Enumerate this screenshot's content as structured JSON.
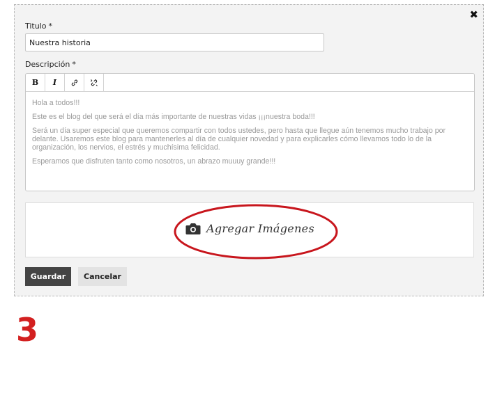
{
  "dialog": {
    "close_icon": "close-icon",
    "title_label": "Titulo",
    "title_value": "Nuestra historia",
    "description_label": "Descripción",
    "required_marker": "*",
    "toolbar": {
      "bold": "B",
      "italic": "I",
      "link_icon": "link-icon",
      "unlink_icon": "unlink-icon"
    },
    "description_paragraphs": [
      "Hola a todos!!!",
      "Este es el blog del que será el día más importante de nuestras vidas ¡¡¡nuestra boda!!!",
      "Será un día super especial que queremos compartir con todos ustedes, pero hasta que llegue aún tenemos mucho trabajo por delante. Usaremos este blog para mantenerles al día de cualquier novedad y para explicarles cómo llevamos todo lo de la organización, los nervios, el estrés y muchísima felicidad.",
      "Esperamos que disfruten tanto como nosotros, un abrazo muuuy grande!!!"
    ],
    "upload": {
      "icon": "camera-icon",
      "label": "Agregar Imágenes"
    },
    "buttons": {
      "save": "Guardar",
      "cancel": "Cancelar"
    }
  },
  "annotation": {
    "step_number": "3",
    "highlight_color": "#c8161d"
  }
}
